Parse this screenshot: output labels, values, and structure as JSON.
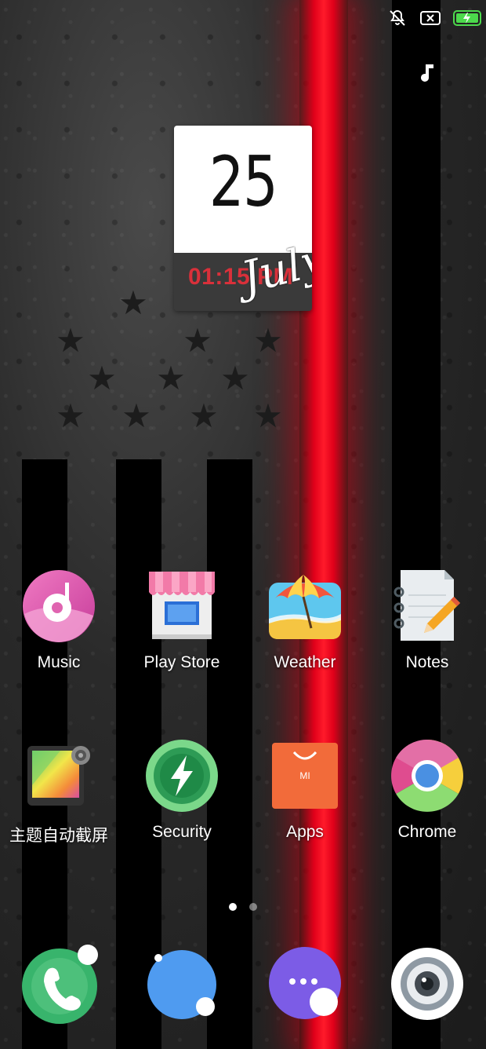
{
  "status_bar": {
    "icons": [
      "mute-bell-icon",
      "sim-x-icon",
      "battery-charging-icon"
    ],
    "battery_color": "#4cd94c"
  },
  "clock_widget": {
    "day": "25",
    "time": "01:15 PM",
    "month": "July"
  },
  "home_apps": [
    {
      "label": "Music",
      "icon": "music-icon"
    },
    {
      "label": "Play Store",
      "icon": "store-icon"
    },
    {
      "label": "Weather",
      "icon": "weather-icon"
    },
    {
      "label": "Notes",
      "icon": "notes-icon"
    },
    {
      "label": "主题自动截屏",
      "icon": "theme-screenshot-icon"
    },
    {
      "label": "Security",
      "icon": "security-icon"
    },
    {
      "label": "Apps",
      "icon": "apps-bag-icon"
    },
    {
      "label": "Chrome",
      "icon": "chrome-icon"
    }
  ],
  "pager": {
    "pages": 2,
    "active_page": 1
  },
  "dock": [
    {
      "icon": "phone-icon"
    },
    {
      "icon": "contacts-icon"
    },
    {
      "icon": "messages-icon"
    },
    {
      "icon": "camera-icon"
    }
  ],
  "colors": {
    "accent_red": "#e0001a",
    "clock_time_red": "#d9303a"
  }
}
